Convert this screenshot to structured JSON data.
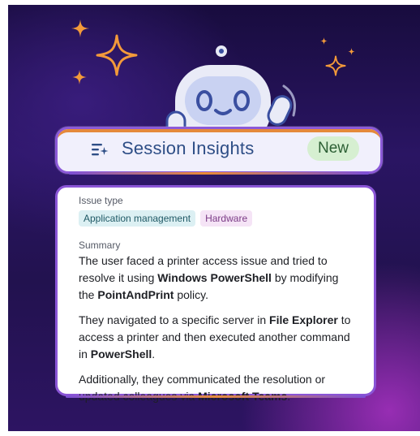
{
  "banner": {
    "title": "Session Insights",
    "badge": "New",
    "icon": "sparkle-list-icon"
  },
  "card": {
    "issue_type_label": "Issue type",
    "tags": [
      "Application management",
      "Hardware"
    ],
    "summary_label": "Summary",
    "paragraphs": [
      {
        "p1_a": "The user faced a printer access issue and tried to resolve it using ",
        "p1_b": "Windows PowerShell",
        "p1_c": " by modifying the ",
        "p1_d": "PointAndPrint",
        "p1_e": " policy."
      },
      {
        "p2_a": "They navigated to a specific server in ",
        "p2_b": "File Explorer",
        "p2_c": " to access a printer and then executed another command in ",
        "p2_d": "PowerShell",
        "p2_e": "."
      },
      {
        "p3_a": "Additionally, they communicated the resolution or updated colleagues via ",
        "p3_b": "Microsoft Teams",
        "p3_c": "."
      }
    ]
  },
  "colors": {
    "accent_purple": "#8a55d6",
    "accent_orange": "#ea8a35",
    "title_blue": "#2e4e86",
    "badge_green_bg": "#d6efd1"
  }
}
